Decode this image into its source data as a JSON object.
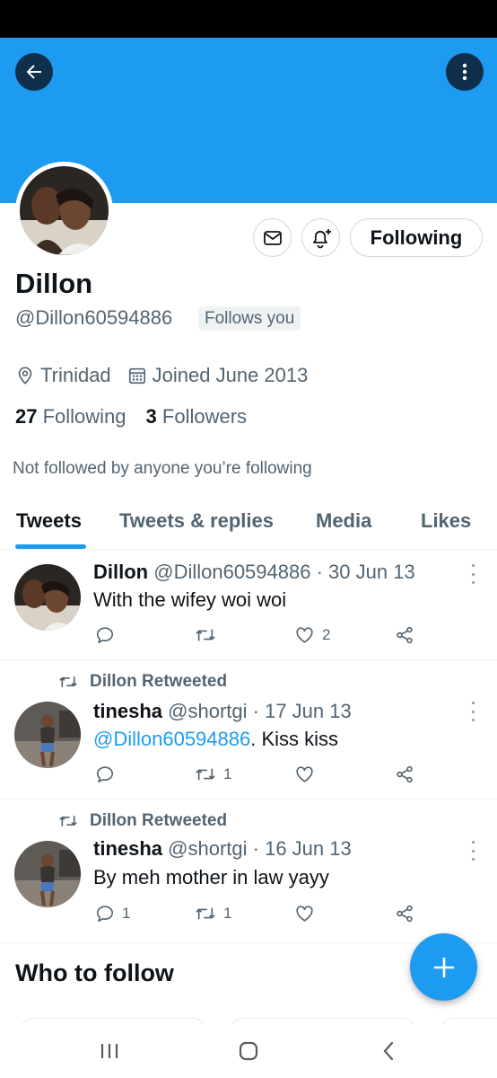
{
  "profile": {
    "name": "Dillon",
    "handle": "@Dillon60594886",
    "follows_you": "Follows you",
    "location": "Trinidad",
    "joined": "Joined June 2013",
    "following_count": "27",
    "following_label": "Following",
    "followers_count": "3",
    "followers_label": "Followers",
    "not_followed_text": "Not followed by anyone you’re following",
    "following_button": "Following"
  },
  "tabs": [
    {
      "label": "Tweets",
      "active": true
    },
    {
      "label": "Tweets & replies",
      "active": false
    },
    {
      "label": "Media",
      "active": false
    },
    {
      "label": "Likes",
      "active": false
    }
  ],
  "tweets": [
    {
      "retweeted_by": "",
      "author": "Dillon",
      "handle": "@Dillon60594886",
      "date": "· 30 Jun 13",
      "mention": "",
      "text": "With the wifey woi woi",
      "replies": "",
      "retweets": "",
      "likes": "2"
    },
    {
      "retweeted_by": "Dillon Retweeted",
      "author": "tinesha",
      "handle": "@shortgi",
      "date": "· 17 Jun 13",
      "mention": "@Dillon60594886",
      "text": ". Kiss kiss",
      "replies": "",
      "retweets": "1",
      "likes": ""
    },
    {
      "retweeted_by": "Dillon Retweeted",
      "author": "tinesha",
      "handle": "@shortgi",
      "date": "· 16 Jun 13",
      "mention": "",
      "text": "By meh mother in law yayy",
      "replies": "1",
      "retweets": "1",
      "likes": ""
    }
  ],
  "who_to_follow": {
    "title": "Who to follow"
  },
  "icons": {
    "back": "back-arrow-icon",
    "more": "more-vertical-icon",
    "mail": "mail-icon",
    "notify": "bell-plus-icon",
    "location": "location-pin-icon",
    "calendar": "calendar-icon",
    "reply": "reply-icon",
    "retweet": "retweet-icon",
    "like": "heart-icon",
    "share": "share-icon",
    "compose": "plus-icon"
  },
  "colors": {
    "accent": "#1d9bf0",
    "banner": "#1d9bf0",
    "text": "#0f1419",
    "secondary": "#536471"
  }
}
